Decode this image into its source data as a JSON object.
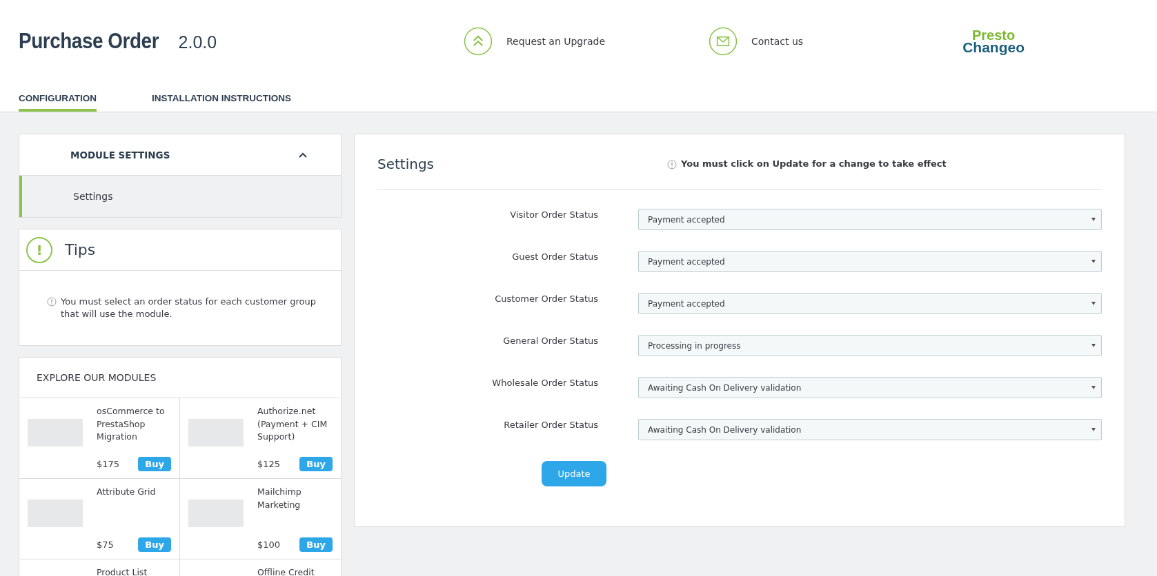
{
  "header": {
    "title": "Purchase Order",
    "version": "2.0.0",
    "links": [
      {
        "kind": "upgrade",
        "label": "Request an Upgrade"
      },
      {
        "kind": "contact",
        "label": "Contact us"
      }
    ],
    "logo": {
      "line_1": "Presto",
      "line_2": "Changeo"
    }
  },
  "tabs": [
    {
      "label": "CONFIGURATION",
      "selected": true
    },
    {
      "label": "INSTALLATION INSTRUCTIONS",
      "selected": false
    }
  ],
  "sidebar": {
    "section_title": "MODULE SETTINGS",
    "expanded": true,
    "items": [
      {
        "label": "Settings",
        "selected": true
      }
    ]
  },
  "tips": {
    "title": "Tips",
    "icon": "!",
    "text": "You must select an order status for each customer group that will use the module."
  },
  "explore": {
    "title": "EXPLORE OUR MODULES",
    "modules": [
      {
        "name": "osCommerce to PrestaShop Migration",
        "price": "$175",
        "button": "Buy"
      },
      {
        "name": "Authorize.net (Payment + CIM Support)",
        "price": "$125",
        "button": "Buy"
      },
      {
        "name": "Attribute Grid",
        "price": "$75",
        "button": "Buy"
      },
      {
        "name": "Mailchimp Marketing",
        "price": "$100",
        "button": "Buy"
      },
      {
        "name": "Product List"
      },
      {
        "name": "Offline Credit"
      }
    ]
  },
  "settings": {
    "title": "Settings",
    "notice": "You must click on Update for a change to take effect",
    "fields": [
      {
        "label": "Visitor Order Status",
        "value": "Payment accepted"
      },
      {
        "label": "Guest Order Status",
        "value": "Payment accepted"
      },
      {
        "label": "Customer Order Status",
        "value": "Payment accepted"
      },
      {
        "label": "General Order Status",
        "value": "Processing in progress"
      },
      {
        "label": "Wholesale Order Status",
        "value": "Awaiting Cash On Delivery validation"
      },
      {
        "label": "Retailer Order Status",
        "value": "Awaiting Cash On Delivery validation"
      }
    ],
    "button": "Update"
  }
}
